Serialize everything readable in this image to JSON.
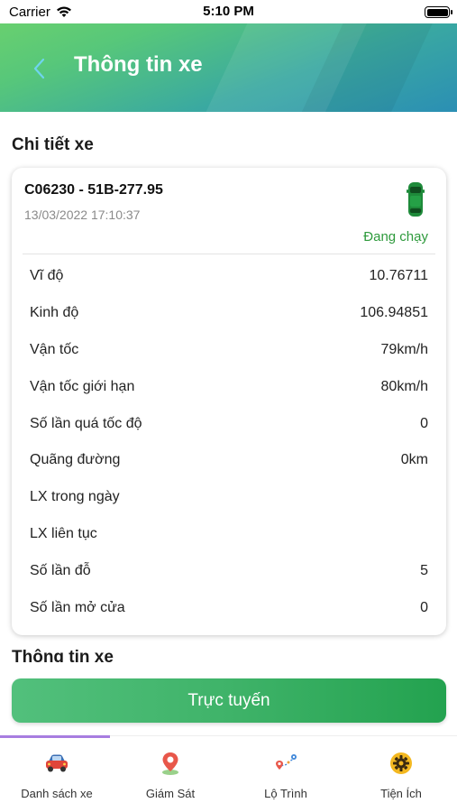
{
  "status_bar": {
    "carrier": "Carrier",
    "time": "5:10 PM"
  },
  "nav": {
    "title": "Thông tin xe",
    "back_icon": "chevron-left-icon"
  },
  "section_detail": {
    "title": "Chi tiết xe"
  },
  "vehicle": {
    "id_plate": "C06230 - 51B-277.95",
    "timestamp": "13/03/2022 17:10:37",
    "status": "Đang chạy",
    "status_color": "#2e9a3c",
    "icon": "car-icon"
  },
  "rows": [
    {
      "label": "Vĩ độ",
      "value": "10.76711"
    },
    {
      "label": "Kinh độ",
      "value": "106.94851"
    },
    {
      "label": "Vận tốc",
      "value": "79km/h"
    },
    {
      "label": "Vận tốc giới hạn",
      "value": "80km/h"
    },
    {
      "label": "Số lần quá tốc độ",
      "value": "0"
    },
    {
      "label": "Quãng đường",
      "value": "0km"
    },
    {
      "label": "LX trong ngày",
      "value": ""
    },
    {
      "label": "LX liên tục",
      "value": ""
    },
    {
      "label": "Số lần đỗ",
      "value": "5"
    },
    {
      "label": "Số lần mở cửa",
      "value": "0"
    }
  ],
  "section_info": {
    "title": "Thông tin xe"
  },
  "button": {
    "label": "Trực tuyến"
  },
  "tabs": [
    {
      "label": "Danh sách xe",
      "icon": "car-list-icon"
    },
    {
      "label": "Giám Sát",
      "icon": "map-pin-icon"
    },
    {
      "label": "Lộ Trình",
      "icon": "route-icon"
    },
    {
      "label": "Tiện Ích",
      "icon": "gear-icon"
    }
  ],
  "colors": {
    "accent": "#3fb369",
    "header_start": "#6fd36b",
    "header_end": "#2b8fb4",
    "tab_indicator": "#a77de0"
  }
}
